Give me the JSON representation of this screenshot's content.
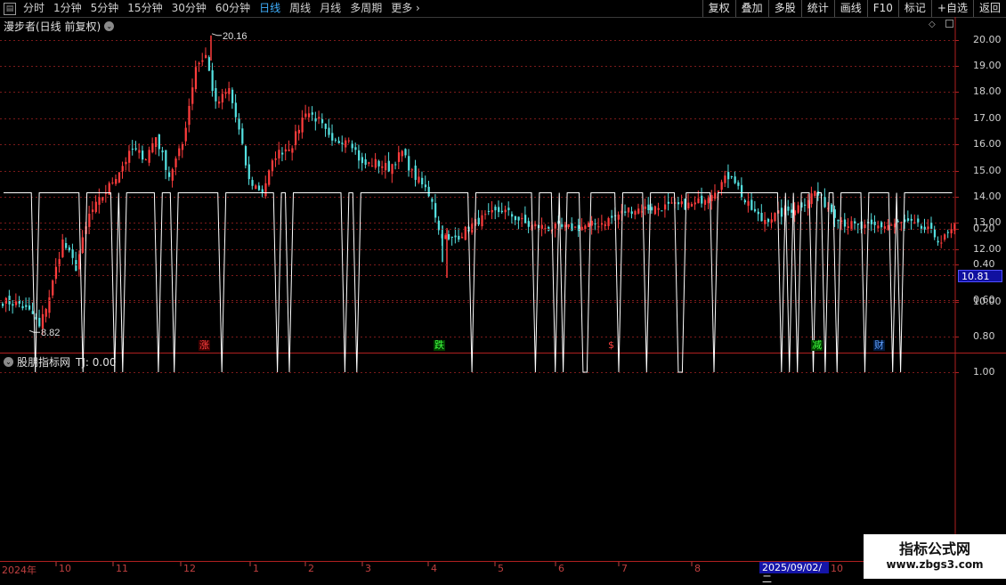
{
  "toolbar": {
    "periods": [
      "分时",
      "1分钟",
      "5分钟",
      "15分钟",
      "30分钟",
      "60分钟",
      "日线",
      "周线",
      "月线",
      "多周期",
      "更多"
    ],
    "active_period": "日线",
    "more_arrow": "›",
    "buttons": [
      "复权",
      "叠加",
      "多股",
      "统计",
      "画线",
      "F10",
      "标记",
      "+自选",
      "返回"
    ]
  },
  "main_chart": {
    "title": "漫步者(日线 前复权)",
    "high_label": "20.16",
    "low_label": "8.82",
    "current_price_tag": "10.81",
    "price_axis": [
      "20.00",
      "19.00",
      "18.00",
      "17.00",
      "16.00",
      "15.00",
      "14.00",
      "13.00",
      "12.00",
      "10.00"
    ],
    "markers": [
      {
        "text": "涨",
        "color": "#ff4040",
        "bg": "#400000"
      },
      {
        "text": "跌",
        "color": "#40ff40",
        "bg": "#004000"
      },
      {
        "text": "$",
        "color": "#ff4040",
        "bg": "#000000"
      },
      {
        "text": "减",
        "color": "#40ff40",
        "bg": "#004000"
      },
      {
        "text": "财",
        "color": "#60a0ff",
        "bg": "#001a40"
      }
    ],
    "colors": {
      "up": "#ff3c3c",
      "down": "#54e0e0",
      "grid": "#7a1a1a",
      "border": "#b02020"
    }
  },
  "indicator": {
    "title": "股朋指标网",
    "value_label": "TJ: 0.00",
    "axis": [
      "1.00",
      "0.80",
      "0.60",
      "0.40",
      "0.20"
    ],
    "spike_bars": [
      8,
      20,
      28,
      30,
      39,
      43,
      55,
      69,
      72,
      86,
      89,
      118,
      134,
      139,
      141,
      146,
      147,
      155,
      162,
      170,
      171,
      179,
      196,
      198,
      200,
      204,
      207,
      210,
      217,
      224,
      226
    ],
    "total_bars": 240
  },
  "time_axis": {
    "labels": [
      "2024年",
      "10",
      "11",
      "12",
      "1",
      "2",
      "3",
      "4",
      "5",
      "6",
      "7",
      "8"
    ],
    "selected_date": "2025/09/02/二",
    "after_label": "10"
  },
  "watermark": {
    "line1": "指标公式网",
    "line2": "www.zbgs3.com"
  }
}
